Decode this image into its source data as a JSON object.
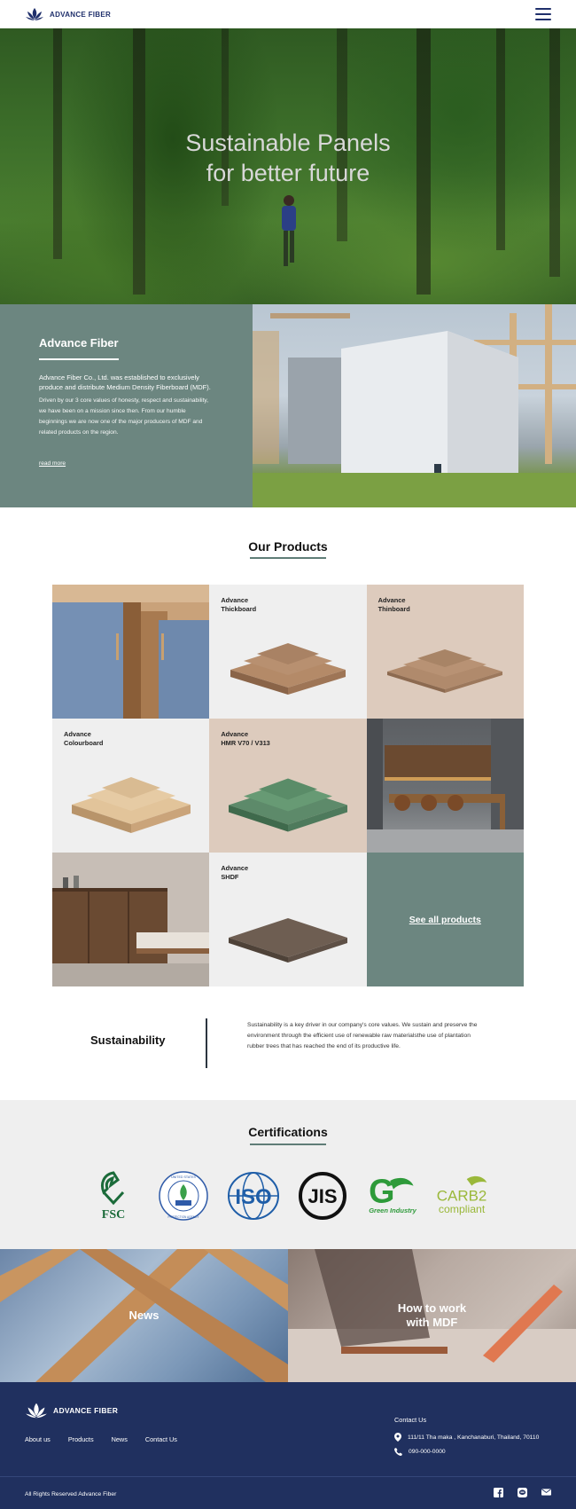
{
  "header": {
    "brand": "ADVANCE FIBER",
    "menu_icon": "hamburger-menu-icon"
  },
  "hero": {
    "title_line1": "Sustainable Panels",
    "title_line2": "for better future"
  },
  "about": {
    "title": "Advance Fiber",
    "lead": "Advance Fiber Co., Ltd. was established to exclusively produce and distribute Medium Density Fiberboard (MDF).",
    "body": "Driven by   our 3 core values of honesty, respect and sustainability, we have been on a mission since then. From our   humble beginnings we are now one of the major producers of MDF and related products on the region.",
    "link": "read more"
  },
  "products": {
    "title": "Our Products",
    "items": [
      {
        "label": ""
      },
      {
        "label": "Advance\nThickboard"
      },
      {
        "label": "Advance\nThinboard"
      },
      {
        "label": "Advance\nColourboard"
      },
      {
        "label": "Advance\nHMR V70 / V313"
      },
      {
        "label": ""
      },
      {
        "label": ""
      },
      {
        "label": "Advance\nSHDF"
      }
    ],
    "see_all": "See all products"
  },
  "sustainability": {
    "title": "Sustainability",
    "text": "Sustainability is a key driver in our company's core values. We sustain and preserve the environment through the efficient use of renewable raw materialsthe use of plantation rubber trees that has reached the end of its productive life."
  },
  "certifications": {
    "title": "Certifications",
    "fsc": "FSC",
    "epa": "UNITED STATES · ENVIRONMENTAL PROTECTION AGENCY",
    "iso": "ISO",
    "jis": "JIS",
    "green": "Green Industry",
    "carb_line1": "CARB2",
    "carb_line2": "compliant"
  },
  "tiles": {
    "news": "News",
    "how": "How to work\nwith MDF"
  },
  "footer": {
    "brand": "ADVANCE FIBER",
    "links": [
      "About us",
      "Products",
      "News",
      "Contact Us"
    ],
    "contact_title": "Contact Us",
    "address": "111/11  Tha maka , Kanchanaburi, Thailand, 70110",
    "phone": "090-000-0000",
    "copyright": "All Rights Reserved Advance Fiber"
  },
  "colors": {
    "navy": "#20305f",
    "teal": "#6c8680",
    "tan": "#ddcbbd",
    "light": "#efefef"
  }
}
